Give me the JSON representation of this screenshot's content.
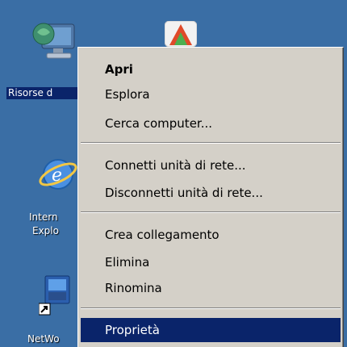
{
  "desktop": {
    "icons": [
      {
        "label": "Risorse d",
        "name": "my-computer-icon"
      },
      {
        "label": "Intern",
        "label2": "Explo",
        "name": "internet-explorer-icon"
      },
      {
        "label": "NetWo",
        "name": "network-shortcut-icon"
      }
    ]
  },
  "context_menu": {
    "items": [
      {
        "label": "Apri"
      },
      {
        "label": "Esplora"
      },
      {
        "label": "Cerca computer..."
      },
      {
        "label": "Connetti unità di rete..."
      },
      {
        "label": "Disconnetti unità di rete..."
      },
      {
        "label": "Crea collegamento"
      },
      {
        "label": "Elimina"
      },
      {
        "label": "Rinomina"
      },
      {
        "label": "Proprietà"
      }
    ]
  },
  "colors": {
    "desktop_background": "#3a6ea5",
    "selection": "#0a246a",
    "menu_background": "#d4d0c8"
  }
}
